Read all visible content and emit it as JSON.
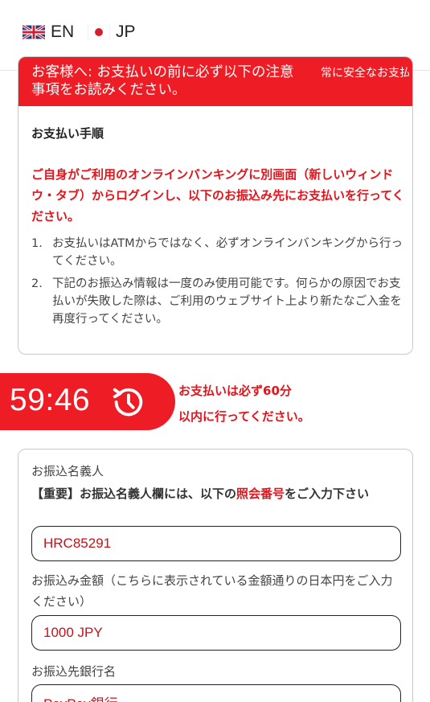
{
  "languages": [
    {
      "code_label": "EN",
      "flag": "uk-flag-icon"
    },
    {
      "code_label": "JP",
      "flag": "japan-flag-icon"
    }
  ],
  "notice": {
    "header_text": "お客様へ: お支払いの前に必ず以下の注意事項をお読みください。",
    "header_side": "常に安全なお支払いを",
    "steps_title": "お支払い手順",
    "alert": "ご自身がご利用のオンラインバンキングに別画面（新しいウィンドウ・タブ）からログインし、以下のお振込み先にお支払いを行ってください。",
    "steps": [
      {
        "num": "1.",
        "text": "お支払いはATMからではなく、必ずオンラインバンキングから行ってください。"
      },
      {
        "num": "2.",
        "text": "下記のお振込み情報は一度のみ使用可能です。何らかの原因でお支払いが失敗した際は、ご利用のウェブサイト上より新たなご入金を再度行ってください。"
      }
    ]
  },
  "timer": {
    "value": "59:46",
    "message_line1": "お支払いは必ず60分",
    "message_line2": "以内に行ってください。"
  },
  "form": {
    "name_label": "お振込名義人",
    "name_note_prefix": "【重要】お振込名義人欄には、以下の",
    "name_note_highlight": "照会番号",
    "name_note_suffix": "をご入力下さい",
    "name_value": "HRC85291",
    "amount_label": "お振込み金額（こちらに表示されている金額通りの日本円をご入力ください）",
    "amount_value": "1000 JPY",
    "bank_label": "お振込先銀行名",
    "bank_value": "PayPay銀行"
  },
  "colors": {
    "accent": "#ee1c25",
    "accent_text": "#e2141c"
  }
}
